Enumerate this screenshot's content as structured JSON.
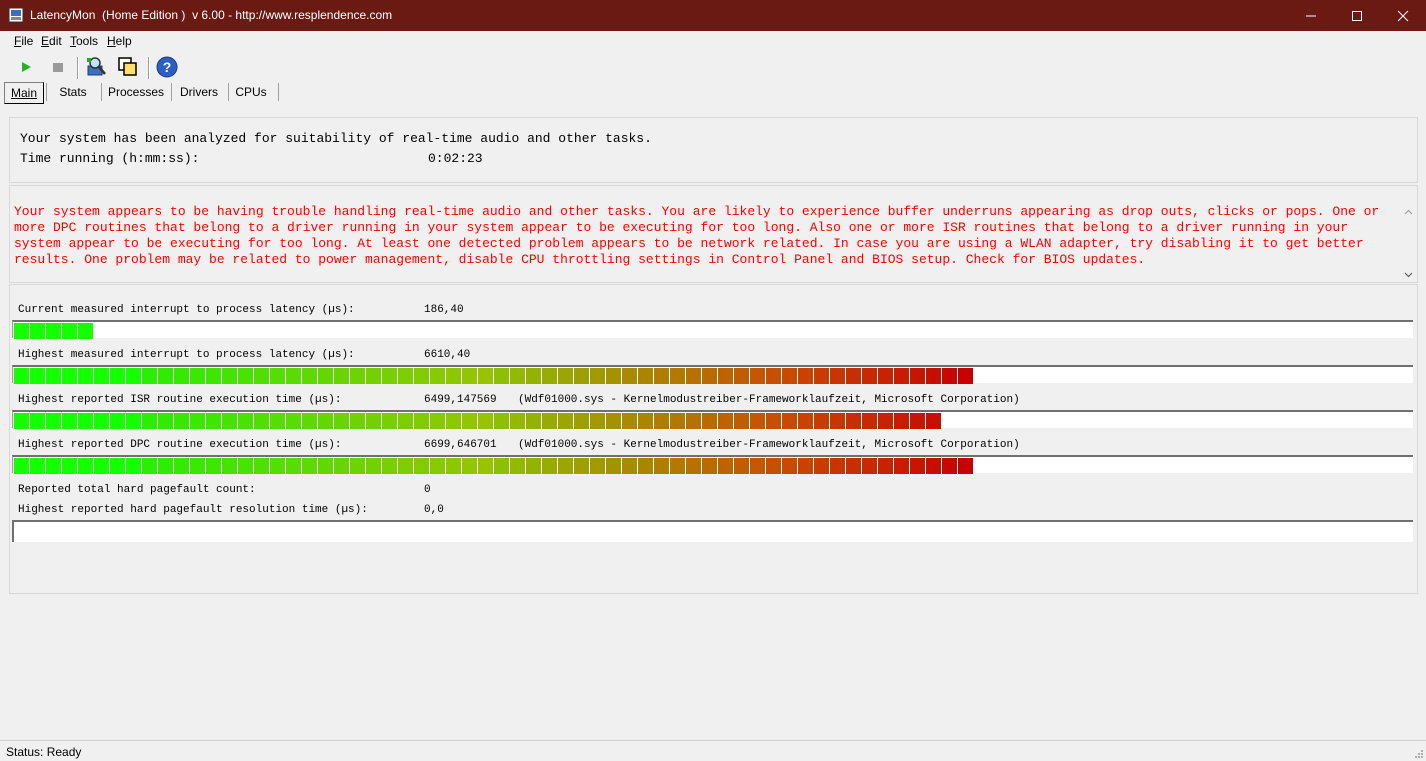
{
  "window": {
    "title": "LatencyMon  (Home Edition )  v 6.00 - http://www.resplendence.com",
    "title_bar_color": "#6b1a13"
  },
  "menu": [
    {
      "label": "File",
      "key": "F",
      "rest": "ile"
    },
    {
      "label": "Edit",
      "key": "E",
      "rest": "dit"
    },
    {
      "label": "Tools",
      "key": "T",
      "rest": "ools"
    },
    {
      "label": "Help",
      "key": "H",
      "rest": "elp"
    }
  ],
  "toolbar": {
    "icons": [
      "play-icon",
      "stop-icon",
      "analyze-icon",
      "windows-icon",
      "help-icon"
    ]
  },
  "tabs": [
    "Main",
    "Stats",
    "Processes",
    "Drivers",
    "CPUs"
  ],
  "active_tab": "Main",
  "summary": {
    "line1": "Your system has been analyzed for suitability of real-time audio and other tasks.",
    "time_label": "Time running (h:mm:ss):",
    "time_value": "0:02:23"
  },
  "warning": {
    "text": "Your system appears to be having trouble handling real-time audio and other tasks. You are likely to experience buffer underruns appearing as drop outs, clicks or pops. One or more DPC routines that belong to a driver running in your system appear to be executing for too long. Also one or more ISR routines that belong to a driver running in your system appear to be executing for too long. At least one detected problem appears to be network related. In case you are using a WLAN adapter, try disabling it to get better results. One problem may be related to power management, disable CPU throttling settings in Control Panel and BIOS setup. Check for BIOS updates.",
    "color": "#ff0000"
  },
  "metrics": {
    "current_latency": {
      "label": "Current measured interrupt to process latency (µs):",
      "value": "186,40",
      "level": 0.056
    },
    "highest_latency": {
      "label": "Highest measured interrupt to process latency (µs):",
      "value": "6610,40",
      "level": 0.684
    },
    "isr": {
      "label": "Highest reported ISR routine execution time (µs):",
      "value": "6499,147569",
      "detail": "(Wdf01000.sys - Kernelmodustreiber-Frameworklaufzeit, Microsoft Corporation)",
      "level": 0.672
    },
    "dpc": {
      "label": "Highest reported DPC routine execution time (µs):",
      "value": "6699,646701",
      "detail": "(Wdf01000.sys - Kernelmodustreiber-Frameworklaufzeit, Microsoft Corporation)",
      "level": 0.684
    },
    "pagefault_count": {
      "label": "Reported total hard pagefault count:",
      "value": "0"
    },
    "pagefault_time": {
      "label": "Highest reported hard pagefault resolution time (µs):",
      "value": "0,0",
      "level": 0
    }
  },
  "status": {
    "text": "Status: Ready"
  }
}
